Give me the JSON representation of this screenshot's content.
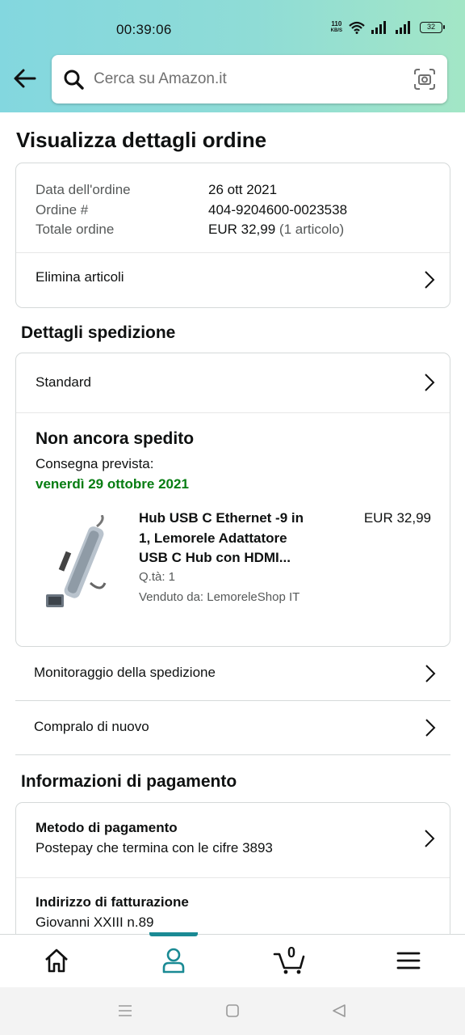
{
  "status_bar": {
    "time": "00:39:06",
    "net_speed_value": "110",
    "net_speed_unit": "KB/S",
    "battery": "32"
  },
  "search": {
    "placeholder": "Cerca su Amazon.it"
  },
  "page": {
    "title": "Visualizza dettagli ordine"
  },
  "order_summary": {
    "rows": [
      {
        "label": "Data dell'ordine",
        "value": "26 ott 2021",
        "extra": ""
      },
      {
        "label": "Ordine #",
        "value": "404-9204600-0023538",
        "extra": ""
      },
      {
        "label": "Totale ordine",
        "value": "EUR 32,99",
        "extra": "(1 articolo)"
      }
    ],
    "delete_items_label": "Elimina articoli"
  },
  "shipping": {
    "section_title": "Dettagli spedizione",
    "method": "Standard",
    "status": "Non ancora spedito",
    "delivery_label": "Consegna prevista:",
    "delivery_date": "venerdì 29 ottobre 2021",
    "delivery_date_color": "#067d12",
    "item": {
      "title_line1": "Hub USB C Ethernet -9 in",
      "title_line2": "1, Lemorele Adattatore",
      "title_line3": "USB C Hub con HDMI...",
      "price": "EUR 32,99",
      "quantity": "Q.tà: 1",
      "seller": "Venduto da: LemoreleShop IT"
    },
    "track_label": "Monitoraggio della spedizione",
    "buy_again_label": "Compralo di nuovo"
  },
  "payment": {
    "section_title": "Informazioni di pagamento",
    "method_title": "Metodo di pagamento",
    "method_value": "Postepay che termina con le cifre 3893",
    "billing_title": "Indirizzo di fatturazione",
    "billing_value": "Giovanni XXIII n.89"
  },
  "bottom_nav": {
    "cart_count": "0",
    "active": "account",
    "accent_color": "#1a8a94"
  }
}
